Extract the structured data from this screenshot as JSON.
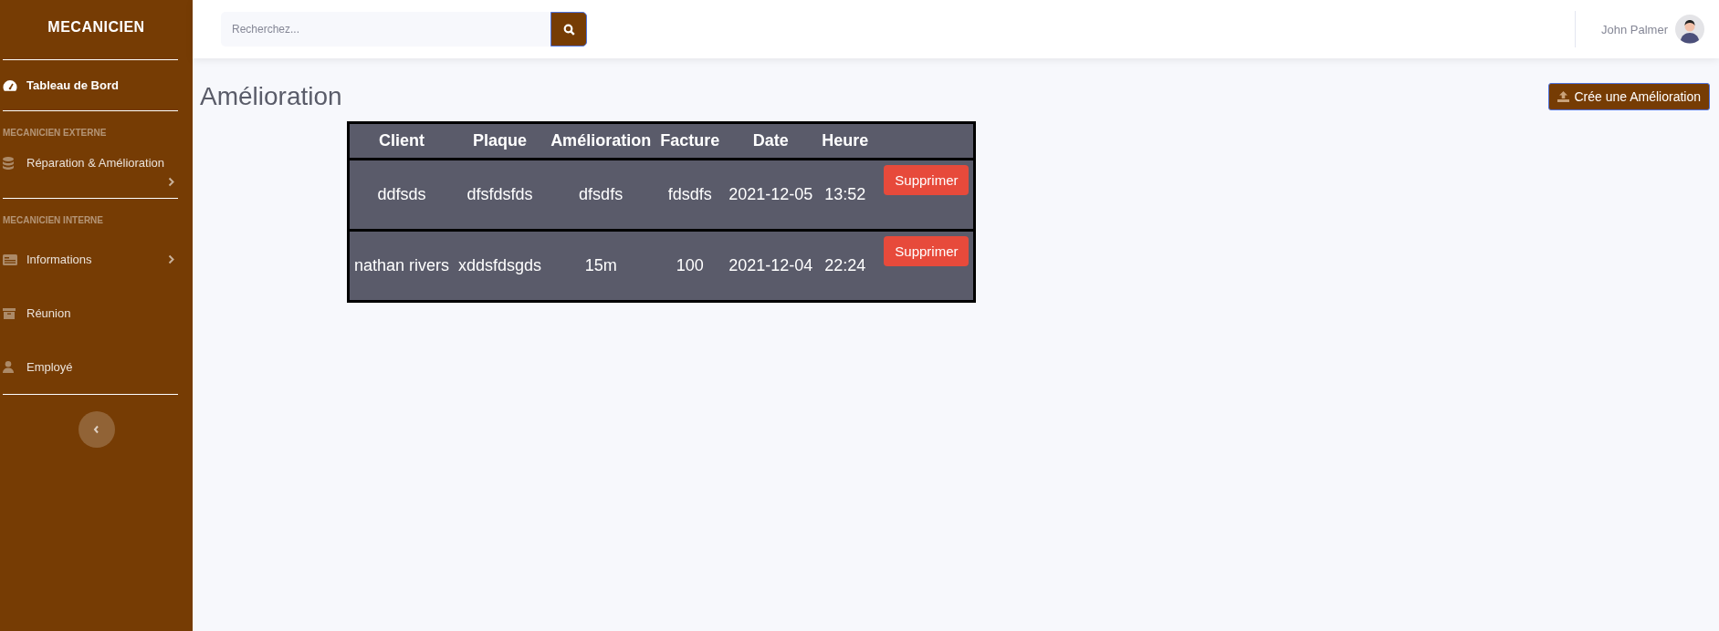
{
  "sidebar": {
    "brand": "MECANICIEN",
    "sections": [
      {
        "items": [
          {
            "label": "Tableau de Bord",
            "kind": "link",
            "selected": true
          }
        ]
      },
      {
        "heading": "MECANICIEN EXTERNE",
        "items": [
          {
            "label": "Réparation & Amélioration",
            "kind": "submenu",
            "selected": false
          }
        ]
      },
      {
        "heading": "MECANICIEN INTERNE",
        "items": [
          {
            "label": "Informations",
            "kind": "submenu",
            "selected": false
          },
          {
            "label": "Réunion",
            "kind": "link",
            "selected": false
          },
          {
            "label": "Employé",
            "kind": "link",
            "selected": false
          }
        ]
      }
    ]
  },
  "topbar": {
    "search": {
      "placeholder": "Recherchez..."
    },
    "user": {
      "name": "John Palmer"
    }
  },
  "page": {
    "title": "Amélioration",
    "create_button": "Crée une Amélioration"
  },
  "table": {
    "columns": [
      "Client",
      "Plaque",
      "Amélioration",
      "Facture",
      "Date",
      "Heure"
    ],
    "rows": [
      {
        "cells": [
          "ddfsds",
          "dfsfdsfds",
          "dfsdfs",
          "fdsdfs",
          "2021-12-05",
          "13:52"
        ],
        "action": "Supprimer"
      },
      {
        "cells": [
          "nathan rivers",
          "xddsfdsgds",
          "15m",
          "100",
          "2021-12-04",
          "22:24"
        ],
        "action": "Supprimer"
      }
    ]
  }
}
